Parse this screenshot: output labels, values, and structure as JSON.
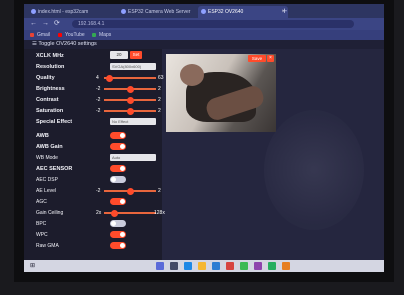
{
  "browser": {
    "tabs": [
      {
        "label": "index.html - esp32cam"
      },
      {
        "label": "ESP32 Camera Web Server"
      },
      {
        "label": "ESP32 OV2640"
      }
    ],
    "new_tab": "+",
    "back": "←",
    "forward": "→",
    "reload": "⟳",
    "url": "192.168.4.1",
    "bookmarks": [
      {
        "label": "Gmail"
      },
      {
        "label": "YouTube"
      },
      {
        "label": "Maps"
      }
    ]
  },
  "page": {
    "header": "☰ Toggle OV2640 settings",
    "xclk": {
      "label": "XCLK MHz",
      "value": "20",
      "button": "Set"
    },
    "resolution": {
      "label": "Resolution",
      "value": "SVGA(800x600)"
    },
    "quality": {
      "label": "Quality",
      "min": "4",
      "max": "63",
      "level": 0.1
    },
    "brightness": {
      "label": "Brightness",
      "min": "-2",
      "max": "2",
      "level": 0.5
    },
    "contrast": {
      "label": "Contrast",
      "min": "-2",
      "max": "2",
      "level": 0.5
    },
    "saturation": {
      "label": "Saturation",
      "min": "-2",
      "max": "2",
      "level": 0.5
    },
    "special_effect": {
      "label": "Special Effect",
      "value": "No Effect"
    },
    "awb": {
      "label": "AWB",
      "on": true
    },
    "awb_gain": {
      "label": "AWB Gain",
      "on": true
    },
    "wb_mode": {
      "label": "WB Mode",
      "value": "Auto"
    },
    "aec_sensor": {
      "label": "AEC SENSOR",
      "on": true
    },
    "aec_dsp": {
      "label": "AEC DSP",
      "on": false
    },
    "ae_level": {
      "label": "AE Level",
      "min": "-2",
      "max": "2",
      "level": 0.5
    },
    "agc": {
      "label": "AGC",
      "on": true
    },
    "gain_ceiling": {
      "label": "Gain Ceiling",
      "min": "2x",
      "max": "128x",
      "level": 0.2
    },
    "bpc": {
      "label": "BPC",
      "on": false
    },
    "wpc": {
      "label": "WPC",
      "on": true
    },
    "raw_gma": {
      "label": "Raw GMA",
      "on": true
    },
    "save_button": "Save",
    "close_button": "×"
  },
  "colors": {
    "accent": "#ff4b2b",
    "panel": "#1c1c2c",
    "page_bg": "#25263f"
  }
}
